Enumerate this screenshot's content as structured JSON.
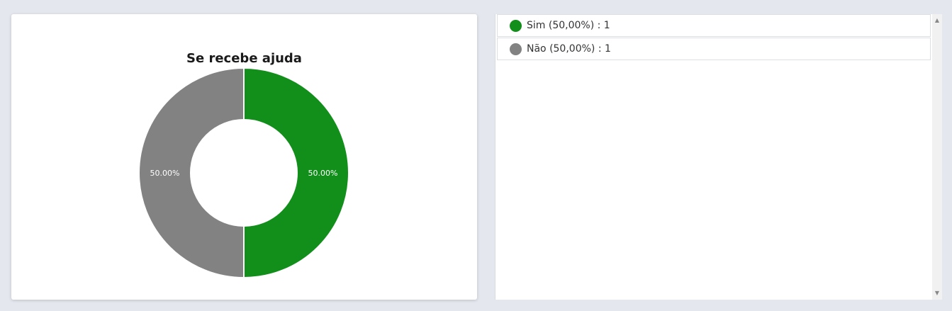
{
  "chart_data": {
    "type": "pie",
    "title": "Se recebe ajuda",
    "categories": [
      "Sim",
      "Não"
    ],
    "values": [
      1,
      1
    ],
    "percent_labels": [
      "50.00%",
      "50.00%"
    ],
    "colors": [
      "#118f1a",
      "#828282"
    ],
    "donut": true,
    "legend_placement": "right"
  },
  "legend": {
    "items": [
      {
        "label": "Sim (50,00%) : 1",
        "color": "#118f1a"
      },
      {
        "label": "Não (50,00%) : 1",
        "color": "#828282"
      }
    ]
  },
  "scrollbar": {
    "up_arrow": "▲",
    "down_arrow": "▼"
  }
}
